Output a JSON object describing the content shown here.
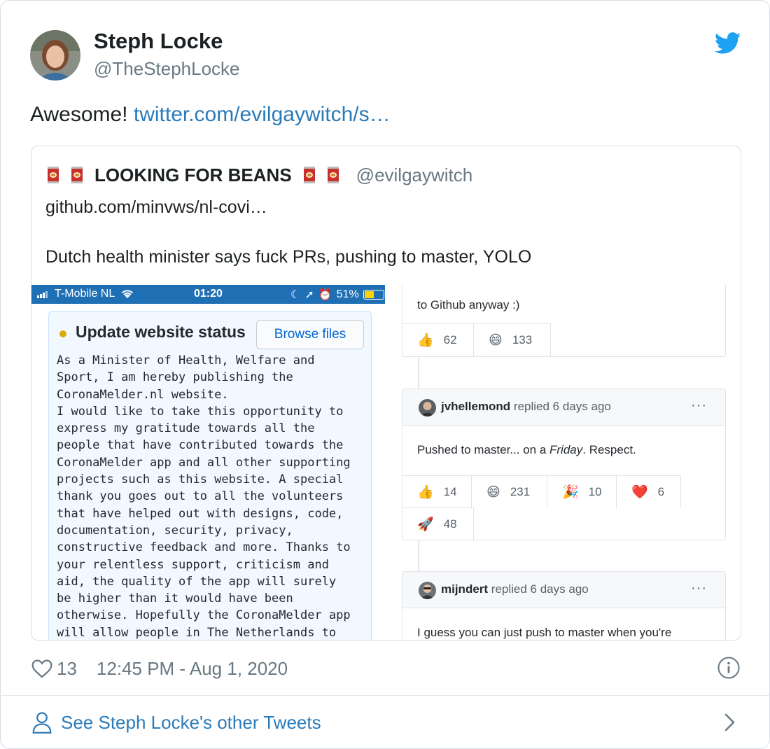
{
  "tweet": {
    "author_name": "Steph Locke",
    "author_handle": "@TheStephLocke",
    "text": "Awesome!",
    "link_text": "twitter.com/evilgaywitch/s…",
    "likes": "13",
    "timestamp": "12:45 PM - Aug 1, 2020"
  },
  "quoted": {
    "name": "LOOKING FOR BEANS",
    "handle": "@evilgaywitch",
    "line1": "github.com/minvws/nl-covi…",
    "line2": "Dutch health minister says fuck PRs, pushing to master, YOLO"
  },
  "phone": {
    "carrier": "T-Mobile NL",
    "time": "01:20",
    "battery": "51%",
    "commit_title": "Update website status",
    "browse_button": "Browse files",
    "commit_body": "As a Minister of Health, Welfare and\nSport, I am hereby publishing the\nCoronaMelder.nl website.\nI would like to take this opportunity to\nexpress my gratitude towards all the\npeople that have contributed towards the\nCoronaMelder app and all other supporting\nprojects such as this website. A special\nthank you goes out to all the volunteers\nthat have helped out with designs, code,\ndocumentation, security, privacy,\nconstructive feedback and more. Thanks to\nyour relentless support, criticism and\naid, the quality of the app will surely\nbe higher than it would have been\notherwise. Hopefully the CoronaMelder app\nwill allow people in The Netherlands to"
  },
  "github": {
    "comment1_tail": "to Github anyway :)",
    "comment1_reactions": [
      {
        "emoji": "👍",
        "count": "62"
      },
      {
        "emoji": "😄",
        "count": "133"
      }
    ],
    "comment2": {
      "user": "jvhellemond",
      "meta": "replied 6 days ago",
      "text_before": "Pushed to master... on a ",
      "text_em": "Friday",
      "text_after": ". Respect.",
      "dots": "···",
      "reactions": [
        {
          "emoji": "👍",
          "count": "14"
        },
        {
          "emoji": "😄",
          "count": "231"
        },
        {
          "emoji": "🎉",
          "count": "10"
        },
        {
          "emoji": "❤️",
          "count": "6"
        }
      ],
      "reactions_row2": [
        {
          "emoji": "🚀",
          "count": "48"
        }
      ]
    },
    "comment3": {
      "user": "mijndert",
      "meta": "replied 6 days ago",
      "text": "I guess you can just push to master when you're",
      "dots": "···"
    }
  },
  "footer": {
    "other_tweets": "See Steph Locke's other Tweets"
  },
  "colors": {
    "link": "#2b7bb9",
    "twitter_blue": "#1da1f2",
    "muted": "#697882",
    "phone_status_bg": "#1f6fb5"
  }
}
